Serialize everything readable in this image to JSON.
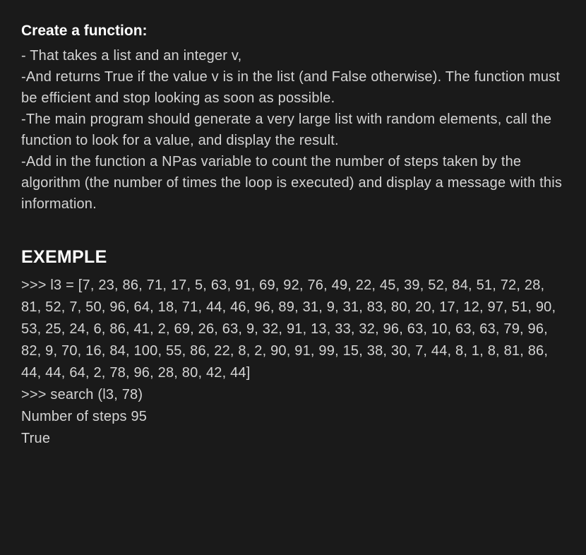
{
  "heading": "Create a function:",
  "req1": "- That takes a list and an integer v,",
  "req2": "-And returns True if the value v is in the list (and False otherwise). The function must be efficient and stop looking as soon as possible.",
  "req3": "-The main program should generate a very large list with random elements, call the function to look for a value, and display the result.",
  "req4": "-Add in the function a NPas variable to count the number of steps taken by the algorithm (the number of times the loop is executed) and display a message with this information.",
  "exampleHeading": "EXEMPLE",
  "exampleLine1": ">>> l3 = [7, 23, 86, 71, 17, 5, 63, 91, 69, 92, 76, 49, 22, 45, 39, 52, 84, 51, 72, 28, 81, 52, 7, 50, 96, 64, 18, 71, 44, 46, 96, 89, 31, 9, 31, 83, 80, 20, 17, 12, 97, 51, 90, 53, 25, 24, 6, 86, 41, 2, 69, 26, 63, 9, 32, 91, 13, 33, 32, 96, 63, 10, 63, 63, 79, 96, 82, 9, 70, 16, 84, 100, 55, 86, 22, 8, 2, 90, 91, 99, 15, 38, 30, 7, 44, 8, 1, 8, 81, 86, 44, 44, 64, 2, 78, 96, 28, 80, 42, 44]",
  "exampleLine2": ">>> search (l3, 78)",
  "exampleLine3": "Number of steps 95",
  "exampleLine4": "True"
}
